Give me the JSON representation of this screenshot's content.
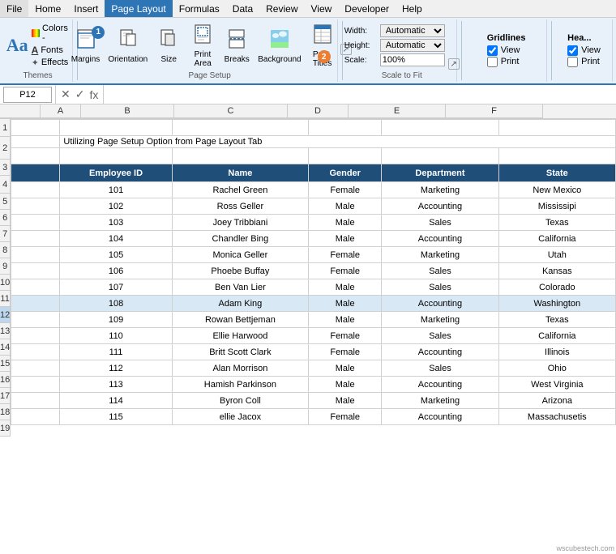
{
  "menubar": {
    "items": [
      "File",
      "Home",
      "Insert",
      "Page Layout",
      "Formulas",
      "Data",
      "Review",
      "View",
      "Developer",
      "Help"
    ]
  },
  "ribbon": {
    "themes_group_label": "Themes",
    "themes": {
      "aa_label": "Aa",
      "colors": "Colors -",
      "fonts": "Fonts",
      "effects": "Effects"
    },
    "page_setup_group_label": "Page Setup",
    "buttons": {
      "margins": "Margins",
      "orientation": "Orientation",
      "size": "Size",
      "print_area": "Print\nArea",
      "breaks": "Breaks",
      "background": "Background",
      "print_titles": "Print\nTitles"
    },
    "scale_group_label": "Scale to Fit",
    "width_label": "Width:",
    "height_label": "Height:",
    "scale_label": "Scale:",
    "width_value": "Automatic",
    "height_value": "Automatic",
    "scale_value": "100%",
    "gridlines_label": "Gridlines",
    "view_label": "View",
    "print_label": "Print",
    "headings_label": "Hea...",
    "badge1": "1",
    "badge2": "2"
  },
  "formula_bar": {
    "name_box": "P12",
    "formula": ""
  },
  "columns": {
    "corner": "",
    "headers": [
      "A",
      "B",
      "C",
      "D",
      "E",
      "F"
    ]
  },
  "title_row": "Utilizing Page Setup Option from Page Layout Tab",
  "table_headers": [
    "Employee ID",
    "Name",
    "Gender",
    "Department",
    "State"
  ],
  "rows": [
    [
      "101",
      "Rachel Green",
      "Female",
      "Marketing",
      "New Mexico"
    ],
    [
      "102",
      "Ross Geller",
      "Male",
      "Accounting",
      "Mississipi"
    ],
    [
      "103",
      "Joey Tribbiani",
      "Male",
      "Sales",
      "Texas"
    ],
    [
      "104",
      "Chandler Bing",
      "Male",
      "Accounting",
      "California"
    ],
    [
      "105",
      "Monica Geller",
      "Female",
      "Marketing",
      "Utah"
    ],
    [
      "106",
      "Phoebe Buffay",
      "Female",
      "Sales",
      "Kansas"
    ],
    [
      "107",
      "Ben Van Lier",
      "Male",
      "Sales",
      "Colorado"
    ],
    [
      "108",
      "Adam King",
      "Male",
      "Accounting",
      "Washington"
    ],
    [
      "109",
      "Rowan Bettjeman",
      "Male",
      "Marketing",
      "Texas"
    ],
    [
      "110",
      "Ellie Harwood",
      "Female",
      "Sales",
      "California"
    ],
    [
      "111",
      "Britt Scott Clark",
      "Female",
      "Accounting",
      "Illinois"
    ],
    [
      "112",
      "Alan Morrison",
      "Male",
      "Sales",
      "Ohio"
    ],
    [
      "113",
      "Hamish Parkinson",
      "Male",
      "Accounting",
      "West Virginia"
    ],
    [
      "114",
      "Byron Coll",
      "Male",
      "Marketing",
      "Arizona"
    ],
    [
      "115",
      "ellie Jacox",
      "Female",
      "Accounting",
      "Massachusetis"
    ]
  ],
  "row_numbers": [
    "1",
    "2",
    "3",
    "4",
    "5",
    "6",
    "7",
    "8",
    "9",
    "10",
    "11",
    "12",
    "13",
    "14",
    "15",
    "16",
    "17",
    "18",
    "19"
  ],
  "selected_row": 12,
  "watermark": "wscubestech.com"
}
